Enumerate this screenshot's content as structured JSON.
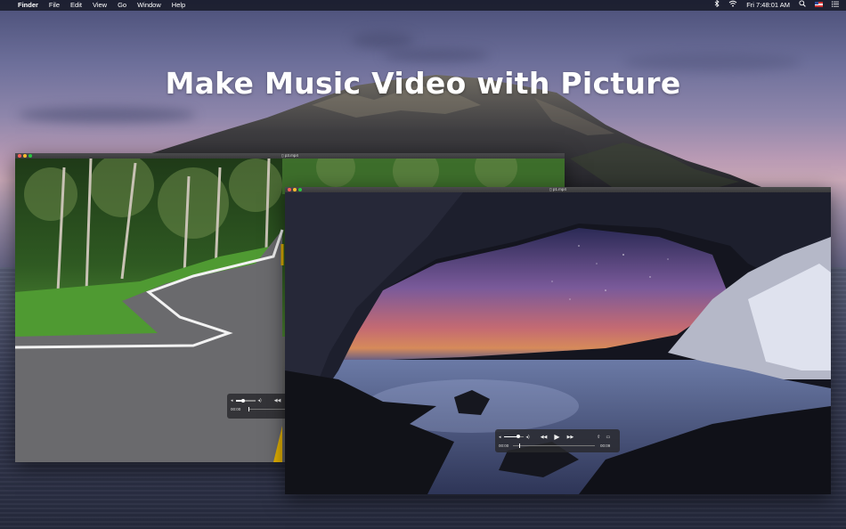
{
  "menubar": {
    "apple_glyph": "",
    "app_name": "Finder",
    "menus": [
      "File",
      "Edit",
      "View",
      "Go",
      "Window",
      "Help"
    ],
    "datetime": "Fri 7:48:01 AM",
    "icons": [
      "bluetooth-icon",
      "wifi-icon",
      "search-icon",
      "flag-icon",
      "list-icon"
    ]
  },
  "headline": "Make Music Video with Picture",
  "windows": [
    {
      "title": "p3.mp4",
      "controls": {
        "time_current": "00:00",
        "volume_percent": 40
      }
    },
    {
      "title": "p1.mp4",
      "controls": {
        "time_current": "00:00",
        "time_total": "00:09",
        "volume_percent": 75,
        "progress_percent": 8
      }
    }
  ],
  "colors": {
    "menubar_bg": "#14161f",
    "close": "#ff5f57",
    "minimize": "#febc2e",
    "zoom": "#28c840"
  }
}
